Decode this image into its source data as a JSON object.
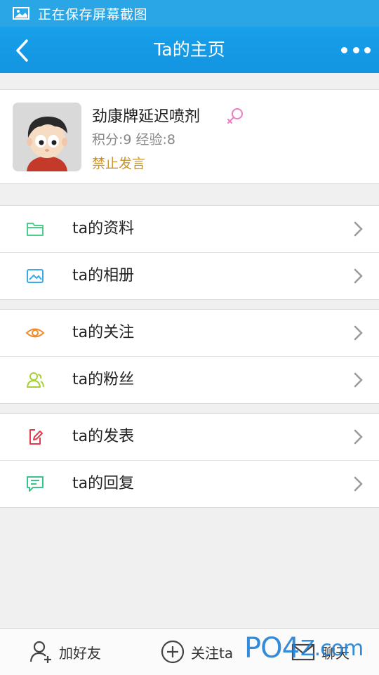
{
  "status_bar": {
    "text": "正在保存屏幕截图"
  },
  "title_bar": {
    "title": "Ta的主页"
  },
  "profile": {
    "name": "劲康牌延迟喷剂",
    "stats": "积分:9 经验:8",
    "status": "禁止发言",
    "gender": "female"
  },
  "menu": {
    "group1": [
      {
        "label": "ta的资料",
        "icon": "folder-icon"
      },
      {
        "label": "ta的相册",
        "icon": "image-icon"
      }
    ],
    "group2": [
      {
        "label": "ta的关注",
        "icon": "eye-icon"
      },
      {
        "label": "ta的粉丝",
        "icon": "users-icon"
      }
    ],
    "group3": [
      {
        "label": "ta的发表",
        "icon": "edit-icon"
      },
      {
        "label": "ta的回复",
        "icon": "comment-icon"
      }
    ]
  },
  "bottom_bar": {
    "add_friend": "加好友",
    "follow": "关注ta",
    "chat": "聊天"
  },
  "watermark": {
    "text": "PO4",
    "tail": "Z.com"
  },
  "colors": {
    "accent": "#1a9de6",
    "status_warning": "#c8962e",
    "gender_female": "#e87fc0"
  }
}
